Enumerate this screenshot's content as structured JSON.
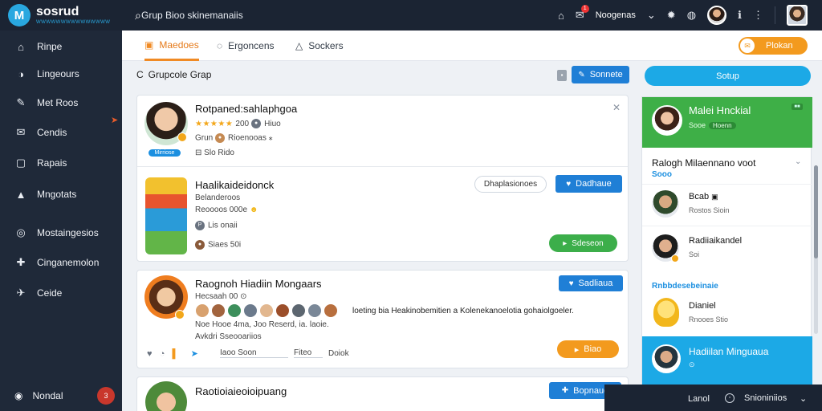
{
  "brand": {
    "name": "sosrud",
    "tagline": "WWWWWWWWWWWWWWW",
    "logo_letter": "M"
  },
  "top": {
    "search_text": "Grup Bioo skinemanaiis",
    "user_label": "Noogenas",
    "notification_count": "1"
  },
  "sidebar": {
    "items": [
      {
        "label": "Rinpe",
        "icon": "⌂"
      },
      {
        "label": "Lingeours",
        "icon": "◑"
      },
      {
        "label": "Met Roos",
        "icon": "✎"
      },
      {
        "label": "Cendis",
        "icon": "✉"
      },
      {
        "label": "Rapais",
        "icon": "▢"
      },
      {
        "label": "Mngotats",
        "icon": "▲"
      },
      {
        "label": "Mostaingesios",
        "icon": "◎"
      },
      {
        "label": "Cinganemolon",
        "icon": "✚"
      },
      {
        "label": "Ceide",
        "icon": "✈"
      }
    ],
    "user": {
      "label": "Nondal",
      "badge": "3"
    }
  },
  "tabs": [
    {
      "label": "Maedoes",
      "icon": "▣",
      "active": true
    },
    {
      "label": "Ergoncens",
      "icon": "◌",
      "active": false
    },
    {
      "label": "Sockers",
      "icon": "△",
      "active": false
    }
  ],
  "tab_action": {
    "label": "Plokan",
    "icon": "✉"
  },
  "main": {
    "title": "Grupcole Grap",
    "header_button": "Sonnete",
    "cyan_button": "Sotup"
  },
  "cards": [
    {
      "title": "Rotpaned:sahlaphgoa",
      "rating_value": "200",
      "rating_suffix": "Hiuo",
      "meta": "Grun",
      "meta2": "Rioenooas ⁎",
      "meta3": "Slo Rido",
      "tag": "Mirriose",
      "rating": 5
    },
    {
      "title": "Haalikaideidonck",
      "line1": "Belanderoos",
      "line2": "Reoooos 000e",
      "line3": "Lis onaii",
      "line4": "Siaes 50i",
      "outline_button": "Dhaplasionoes",
      "blue_button": "Dadhaue",
      "green_button": "Sdeseon"
    },
    {
      "title": "Raognoh Hiadiin Mongaars",
      "line1": "Hecsaah 00 ⊙",
      "body": "loeting bia Heakinobemitien a Kolenekanoelotia gohaiolgoeler.",
      "line2": "Noe Hooe 4ma, Joo Reserd, ia. laoie.",
      "line3": "Avkdri Sseooariios",
      "field1": "Iaoo Soon",
      "field2": "Fiteo",
      "field3": "Doiok",
      "blue_button": "Sadliaua",
      "orange_button": "Biao"
    },
    {
      "title": "Raotioiaieoioipuang",
      "blue_button": "Bopnaue"
    }
  ],
  "right_panel": {
    "header": {
      "name": "Malei Hnckial",
      "sub": "Sooe",
      "tag": "Hoenn"
    },
    "heading": "Ralogh Milaennano voot",
    "heading_sub": "Sooo",
    "rows": [
      {
        "name": "Bcab",
        "sub": "Rostos Sioin"
      },
      {
        "name": "Radiiaikandel",
        "sub": "Soi"
      }
    ],
    "section": "Rnbbdesebeinaie",
    "rows2": [
      {
        "name": "Dianiel",
        "sub": "Rnooes Stio"
      }
    ],
    "footer": {
      "name": "Hadiilan Minguaua",
      "sub": "⊙"
    }
  },
  "bottom_bar": {
    "a": "Lanol",
    "b": "Snioniniios",
    "c": "⌄"
  }
}
